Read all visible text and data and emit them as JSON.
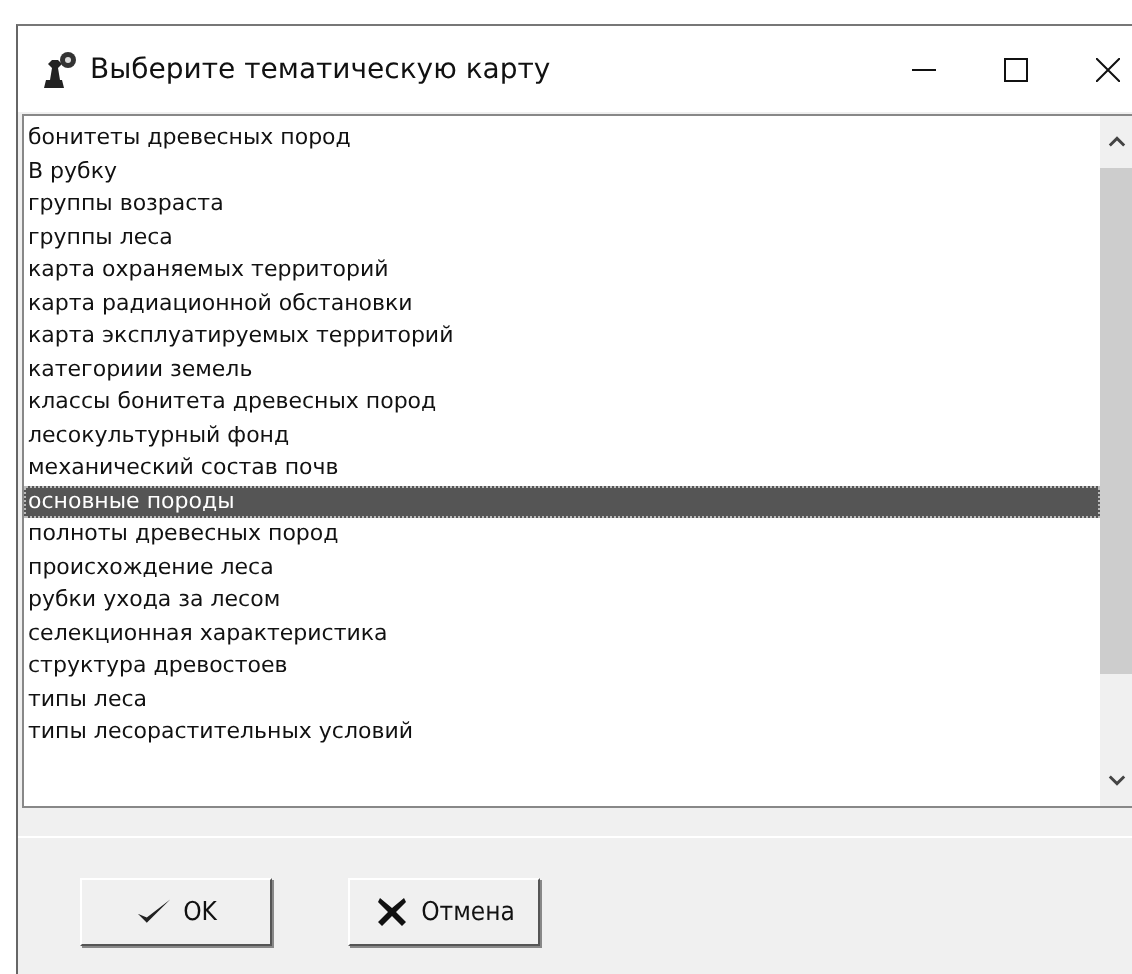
{
  "window": {
    "title": "Выберите тематическую карту"
  },
  "list": {
    "items": [
      {
        "label": "бонитеты древесных пород",
        "selected": false
      },
      {
        "label": "В рубку",
        "selected": false
      },
      {
        "label": "группы возраста",
        "selected": false
      },
      {
        "label": "группы леса",
        "selected": false
      },
      {
        "label": "карта охраняемых территорий",
        "selected": false
      },
      {
        "label": "карта радиационной обстановки",
        "selected": false
      },
      {
        "label": "карта эксплуатируемых территорий",
        "selected": false
      },
      {
        "label": "категориии земель",
        "selected": false
      },
      {
        "label": "классы бонитета древесных пород",
        "selected": false
      },
      {
        "label": "лесокультурный фонд",
        "selected": false
      },
      {
        "label": "механический состав почв",
        "selected": false
      },
      {
        "label": "основные породы",
        "selected": true
      },
      {
        "label": "полноты древесных пород",
        "selected": false
      },
      {
        "label": "происхождение леса",
        "selected": false
      },
      {
        "label": "рубки ухода за лесом",
        "selected": false
      },
      {
        "label": "селекционная характеристика",
        "selected": false
      },
      {
        "label": "структура древостоев",
        "selected": false
      },
      {
        "label": "типы леса",
        "selected": false
      },
      {
        "label": "типы лесорастительных условий",
        "selected": false
      }
    ]
  },
  "buttons": [
    {
      "label": "OK",
      "kind": "ok"
    },
    {
      "label": "Отмена",
      "kind": "cancel"
    }
  ]
}
